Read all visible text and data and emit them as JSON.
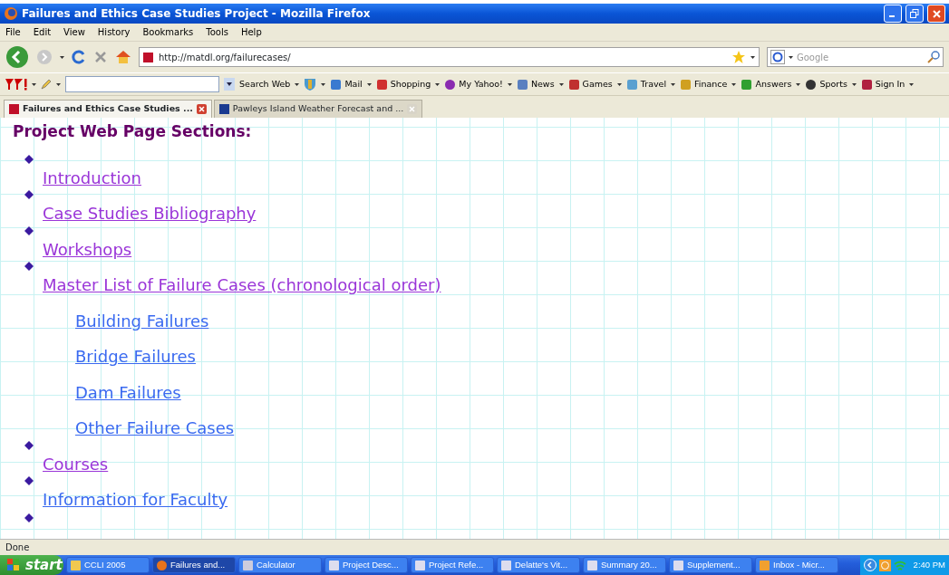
{
  "window": {
    "title": "Failures and Ethics Case Studies Project - Mozilla Firefox"
  },
  "menu": [
    "File",
    "Edit",
    "View",
    "History",
    "Bookmarks",
    "Tools",
    "Help"
  ],
  "address": {
    "url": "http://matdl.org/failurecases/"
  },
  "search": {
    "placeholder": "Google"
  },
  "yahoo_toolbar": {
    "items": [
      "Search Web",
      "Mail",
      "Shopping",
      "My Yahoo!",
      "News",
      "Games",
      "Travel",
      "Finance",
      "Answers",
      "Sports",
      "Sign In"
    ]
  },
  "tabs": [
    {
      "label": "Failures and Ethics Case Studies ...",
      "selected": true
    },
    {
      "label": "Pawleys Island Weather Forecast and ...",
      "selected": false
    }
  ],
  "page": {
    "heading": "Project Web Page Sections:",
    "items": [
      {
        "kind": "link",
        "label": "Introduction",
        "visited": true
      },
      {
        "kind": "link",
        "label": "Case Studies Bibliography",
        "visited": true
      },
      {
        "kind": "link",
        "label": "Workshops",
        "visited": true
      },
      {
        "kind": "link",
        "label": "Master List of Failure Cases (chronological order)",
        "visited": true,
        "children": [
          {
            "label": "Building Failures",
            "visited": false
          },
          {
            "label": "Bridge Failures",
            "visited": false
          },
          {
            "label": "Dam Failures",
            "visited": false
          },
          {
            "label": "Other Failure Cases",
            "visited": false
          }
        ]
      },
      {
        "kind": "link",
        "label": "Courses",
        "visited": true
      },
      {
        "kind": "link",
        "label": "Information for Faculty",
        "visited": false
      },
      {
        "kind": "clipped"
      }
    ]
  },
  "status_bar": "Done",
  "taskbar": {
    "start": "start",
    "items": [
      {
        "label": "CCLI 2005",
        "selected": false
      },
      {
        "label": "Failures and...",
        "selected": true
      },
      {
        "label": "Calculator",
        "selected": false
      },
      {
        "label": "Project Desc...",
        "selected": false
      },
      {
        "label": "Project Refe...",
        "selected": false
      },
      {
        "label": "Delatte's Vit...",
        "selected": false
      },
      {
        "label": "Summary 20...",
        "selected": false
      },
      {
        "label": "Supplement...",
        "selected": false
      },
      {
        "label": "Inbox - Micr...",
        "selected": false
      }
    ],
    "clock": "2:40 PM"
  }
}
